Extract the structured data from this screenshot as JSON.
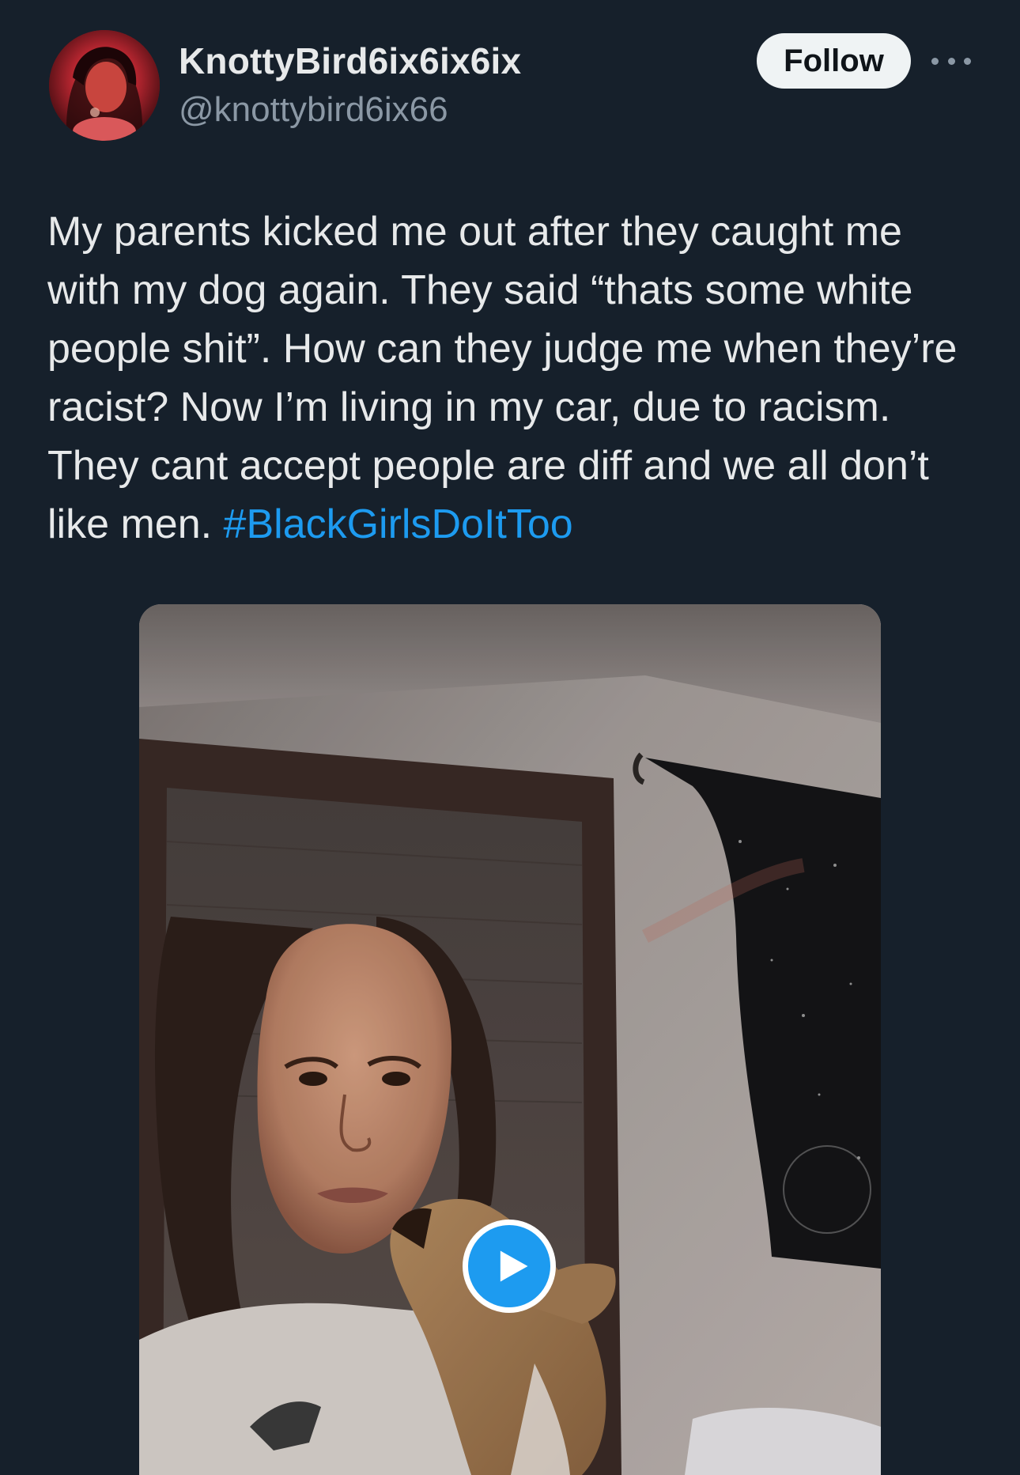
{
  "author": {
    "display_name": "KnottyBird6ix6ix6ix",
    "handle": "@knottybird6ix66"
  },
  "header": {
    "follow_label": "Follow",
    "more_icon": "more-horizontal-icon"
  },
  "tweet": {
    "text": "My parents kicked me out after they caught me with my dog again. They said “thats some white people shit”. How can they judge me when they’re racist? Now I’m living in my car, due to racism. They cant accept people are diff and we all don’t like men. ",
    "hashtag": "#BlackGirlsDoItToo"
  },
  "media": {
    "type": "video",
    "play_icon": "play-icon"
  },
  "colors": {
    "background": "#16202b",
    "text_primary": "#e7e9ea",
    "text_secondary": "#8b98a5",
    "link": "#1d9bf0",
    "follow_bg": "#eff3f4"
  }
}
